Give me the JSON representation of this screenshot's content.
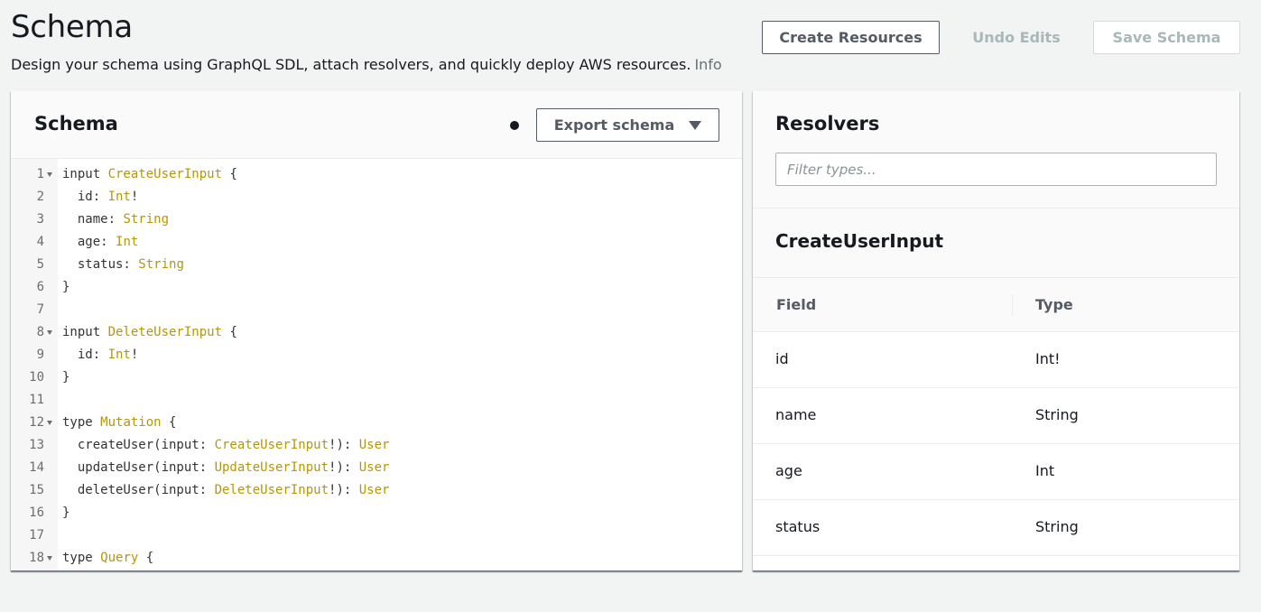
{
  "header": {
    "title": "Schema",
    "description": "Design your schema using GraphQL SDL, attach resolvers, and quickly deploy AWS resources.",
    "info_link": "Info",
    "create_label": "Create Resources",
    "undo_label": "Undo Edits",
    "save_label": "Save Schema"
  },
  "schema_panel": {
    "title": "Schema",
    "export_label": "Export schema"
  },
  "editor": {
    "lines": [
      {
        "n": "1",
        "fold": true,
        "tokens": [
          [
            "kw",
            "input "
          ],
          [
            "tp",
            "CreateUserInput"
          ],
          [
            "pn",
            " {"
          ]
        ]
      },
      {
        "n": "2",
        "tokens": [
          [
            "pn",
            "  id: "
          ],
          [
            "tp",
            "Int"
          ],
          [
            "pn",
            "!"
          ]
        ]
      },
      {
        "n": "3",
        "tokens": [
          [
            "pn",
            "  name: "
          ],
          [
            "tp",
            "String"
          ]
        ]
      },
      {
        "n": "4",
        "tokens": [
          [
            "pn",
            "  age: "
          ],
          [
            "tp",
            "Int"
          ]
        ]
      },
      {
        "n": "5",
        "tokens": [
          [
            "pn",
            "  status: "
          ],
          [
            "tp",
            "String"
          ]
        ]
      },
      {
        "n": "6",
        "tokens": [
          [
            "pn",
            "}"
          ]
        ]
      },
      {
        "n": "7",
        "tokens": []
      },
      {
        "n": "8",
        "fold": true,
        "tokens": [
          [
            "kw",
            "input "
          ],
          [
            "tp",
            "DeleteUserInput"
          ],
          [
            "pn",
            " {"
          ]
        ]
      },
      {
        "n": "9",
        "tokens": [
          [
            "pn",
            "  id: "
          ],
          [
            "tp",
            "Int"
          ],
          [
            "pn",
            "!"
          ]
        ]
      },
      {
        "n": "10",
        "tokens": [
          [
            "pn",
            "}"
          ]
        ]
      },
      {
        "n": "11",
        "tokens": []
      },
      {
        "n": "12",
        "fold": true,
        "tokens": [
          [
            "kw",
            "type "
          ],
          [
            "tp",
            "Mutation"
          ],
          [
            "pn",
            " {"
          ]
        ]
      },
      {
        "n": "13",
        "tokens": [
          [
            "pn",
            "  createUser(input: "
          ],
          [
            "tp",
            "CreateUserInput"
          ],
          [
            "pn",
            "!): "
          ],
          [
            "tp",
            "User"
          ]
        ]
      },
      {
        "n": "14",
        "tokens": [
          [
            "pn",
            "  updateUser(input: "
          ],
          [
            "tp",
            "UpdateUserInput"
          ],
          [
            "pn",
            "!): "
          ],
          [
            "tp",
            "User"
          ]
        ]
      },
      {
        "n": "15",
        "tokens": [
          [
            "pn",
            "  deleteUser(input: "
          ],
          [
            "tp",
            "DeleteUserInput"
          ],
          [
            "pn",
            "!): "
          ],
          [
            "tp",
            "User"
          ]
        ]
      },
      {
        "n": "16",
        "tokens": [
          [
            "pn",
            "}"
          ]
        ]
      },
      {
        "n": "17",
        "tokens": []
      },
      {
        "n": "18",
        "fold": true,
        "tokens": [
          [
            "kw",
            "type "
          ],
          [
            "tp",
            "Query"
          ],
          [
            "pn",
            " {"
          ]
        ]
      }
    ]
  },
  "resolvers": {
    "title": "Resolvers",
    "filter_placeholder": "Filter types...",
    "type_name": "CreateUserInput",
    "columns": [
      "Field",
      "Type"
    ],
    "rows": [
      {
        "field": "id",
        "type": "Int!"
      },
      {
        "field": "name",
        "type": "String"
      },
      {
        "field": "age",
        "type": "Int"
      },
      {
        "field": "status",
        "type": "String"
      }
    ]
  },
  "colors": {
    "type_token": "#b5960b",
    "background": "#f2f3f3"
  }
}
